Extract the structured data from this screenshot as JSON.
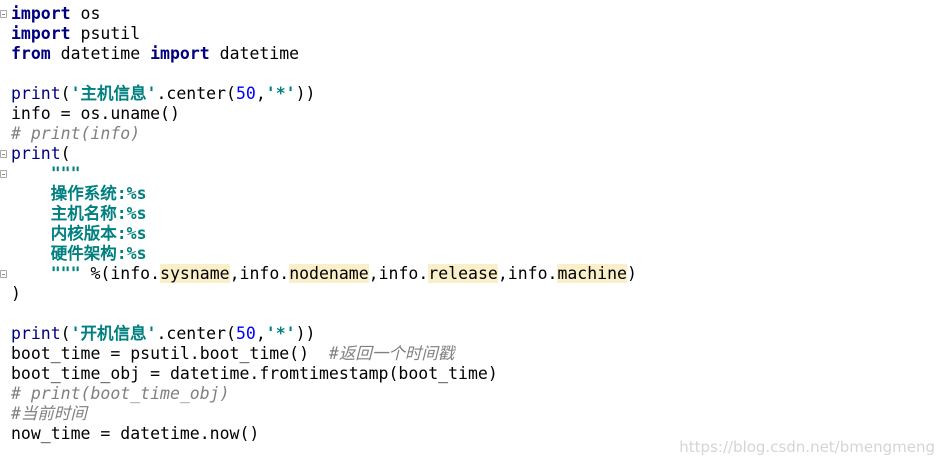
{
  "editor": {
    "lines": [
      [
        {
          "t": "import",
          "c": "kw"
        },
        {
          "t": " os",
          "c": "tx"
        }
      ],
      [
        {
          "t": "import",
          "c": "kw"
        },
        {
          "t": " psutil",
          "c": "tx"
        }
      ],
      [
        {
          "t": "from",
          "c": "kw"
        },
        {
          "t": " datetime ",
          "c": "tx"
        },
        {
          "t": "import",
          "c": "kw"
        },
        {
          "t": " datetime",
          "c": "tx"
        }
      ],
      [],
      [
        {
          "t": "print",
          "c": "fn"
        },
        {
          "t": "(",
          "c": "tx"
        },
        {
          "t": "'主机信息'",
          "c": "str"
        },
        {
          "t": ".center(",
          "c": "tx"
        },
        {
          "t": "50",
          "c": "num"
        },
        {
          "t": ",",
          "c": "tx"
        },
        {
          "t": "'*'",
          "c": "str"
        },
        {
          "t": "))",
          "c": "tx"
        }
      ],
      [
        {
          "t": "info = os.uname()",
          "c": "tx"
        }
      ],
      [
        {
          "t": "# print(info)",
          "c": "cm"
        }
      ],
      [
        {
          "t": "print",
          "c": "fn"
        },
        {
          "t": "(",
          "c": "tx"
        }
      ],
      [
        {
          "t": "    \"\"\"",
          "c": "str"
        }
      ],
      [
        {
          "t": "    操作系统:%s",
          "c": "str"
        }
      ],
      [
        {
          "t": "    主机名称:%s",
          "c": "str"
        }
      ],
      [
        {
          "t": "    内核版本:%s",
          "c": "str"
        }
      ],
      [
        {
          "t": "    硬件架构:%s",
          "c": "str"
        }
      ],
      [
        {
          "t": "    \"\"\"",
          "c": "str"
        },
        {
          "t": " %(info.",
          "c": "tx"
        },
        {
          "t": "sysname",
          "c": "hl"
        },
        {
          "t": ",info.",
          "c": "tx"
        },
        {
          "t": "nodename",
          "c": "hl"
        },
        {
          "t": ",info.",
          "c": "tx"
        },
        {
          "t": "release",
          "c": "hl"
        },
        {
          "t": ",info.",
          "c": "tx"
        },
        {
          "t": "machine",
          "c": "hl"
        },
        {
          "t": ")",
          "c": "tx"
        }
      ],
      [
        {
          "t": ")",
          "c": "tx"
        }
      ],
      [],
      [
        {
          "t": "print",
          "c": "fn"
        },
        {
          "t": "(",
          "c": "tx"
        },
        {
          "t": "'开机信息'",
          "c": "str"
        },
        {
          "t": ".center(",
          "c": "tx"
        },
        {
          "t": "50",
          "c": "num"
        },
        {
          "t": ",",
          "c": "tx"
        },
        {
          "t": "'*'",
          "c": "str"
        },
        {
          "t": "))",
          "c": "tx"
        }
      ],
      [
        {
          "t": "boot_time = psutil.boot_time()  ",
          "c": "tx"
        },
        {
          "t": "#返回一个时间戳",
          "c": "cm"
        }
      ],
      [
        {
          "t": "boot_time_obj = datetime.fromtimestamp(boot_time)",
          "c": "tx"
        }
      ],
      [
        {
          "t": "# print(boot_time_obj)",
          "c": "cm"
        }
      ],
      [
        {
          "t": "#当前时间",
          "c": "cm"
        }
      ],
      [
        {
          "t": "now_time = datetime.now()",
          "c": "tx"
        }
      ]
    ],
    "fold_lines": [
      0,
      7,
      8,
      13
    ]
  },
  "watermark": "https://blog.csdn.net/bmengmeng"
}
